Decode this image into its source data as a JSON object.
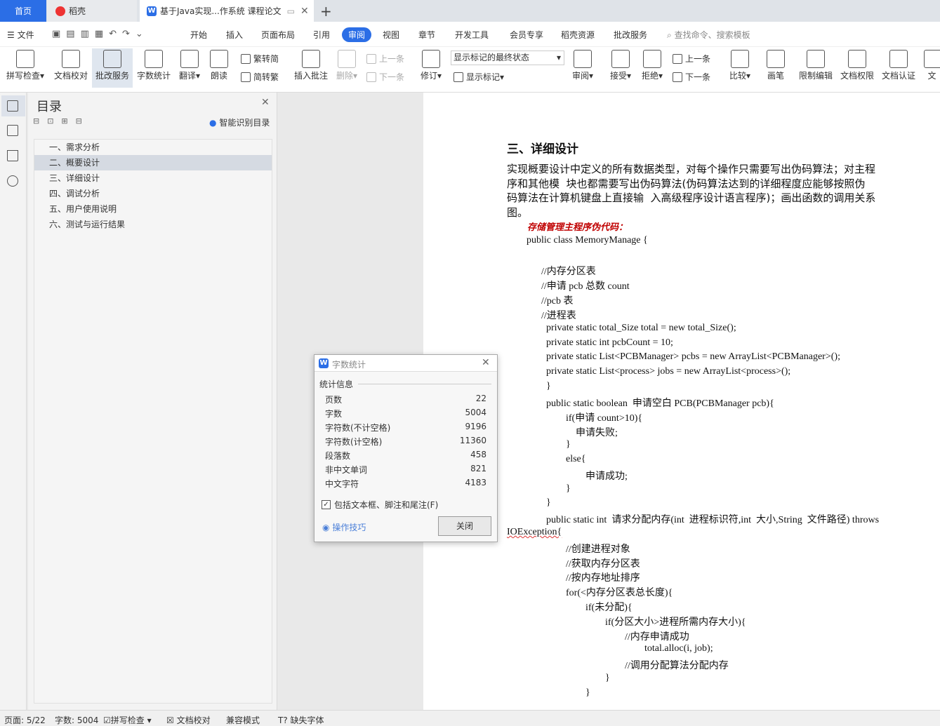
{
  "tabs": {
    "home": "首页",
    "daoke": "稻壳",
    "doc": "基于Java实现...作系统 课程论文"
  },
  "menu": {
    "file": "文件",
    "items": [
      "开始",
      "插入",
      "页面布局",
      "引用",
      "审阅",
      "视图",
      "章节",
      "开发工具",
      "会员专享",
      "稻壳资源",
      "批改服务"
    ],
    "search": "查找命令、搜索模板"
  },
  "ribbon": {
    "spell": "拼写检查",
    "proof": "文档校对",
    "correct": "批改服务",
    "wordcount": "字数统计",
    "translate": "翻译",
    "read": "朗读",
    "trad": "繁转简",
    "simp": "简转繁",
    "insert_comment": "插入批注",
    "delete": "删除",
    "prev": "上一条",
    "next": "下一条",
    "revise": "修订",
    "markup_state": "显示标记的最终状态",
    "show_markup": "显示标记",
    "review": "审阅",
    "accept": "接受",
    "reject": "拒绝",
    "prev2": "上一条",
    "next2": "下一条",
    "compare": "比较",
    "pen": "画笔",
    "restrict": "限制编辑",
    "permission": "文档权限",
    "certify": "文档认证",
    "more": "文"
  },
  "toc": {
    "title": "目录",
    "smart": "智能识别目录",
    "items": [
      "一、需求分析",
      "二、概要设计",
      "三、详细设计",
      "四、调试分析",
      "五、用户使用说明",
      "六、测试与运行结果"
    ],
    "selected_index": 1
  },
  "doc": {
    "heading": "三、详细设计",
    "para": [
      "实现概要设计中定义的所有数据类型，对每个操作只需要写出伪码算法；对主程",
      "序和其他模  块也都需要写出伪码算法(伪码算法达到的详细程度应能够按照伪",
      "码算法在计算机键盘上直接输  入高级程序设计语言程序)；画出函数的调用关系",
      "图。"
    ],
    "code_title": "存储管理主程序伪代码：",
    "code": [
      "public class MemoryManage {",
      "",
      "//内存分区表",
      "//申请 pcb 总数 count",
      "//pcb 表",
      "//进程表",
      "private static total_Size total = new total_Size();",
      "private static int pcbCount = 10;",
      "private static List<PCBManager> pcbs = new ArrayList<PCBManager>();",
      "private static List<process> jobs = new ArrayList<process>();",
      "}",
      "public static boolean  申请空白 PCB(PCBManager pcb){",
      "if(申请 count>10){",
      "申请失败;",
      "}",
      "else{",
      "申请成功;",
      "}",
      "}",
      "public static int  请求分配内存(int  进程标识符,int  大小,String  文件路径) throws",
      "IOException{",
      "//创建进程对象",
      "//获取内存分区表",
      "//按内存地址排序",
      "for(<内存分区表总长度){",
      "if(未分配){",
      "if(分区大小>进程所需内存大小){",
      "//内存申请成功",
      "total.alloc(i, job);",
      "//调用分配算法分配内存",
      "}",
      "}"
    ]
  },
  "dialog": {
    "title": "字数统计",
    "section": "统计信息",
    "rows": [
      {
        "label": "页数",
        "value": "22"
      },
      {
        "label": "字数",
        "value": "5004"
      },
      {
        "label": "字符数(不计空格)",
        "value": "9196"
      },
      {
        "label": "字符数(计空格)",
        "value": "11360"
      },
      {
        "label": "段落数",
        "value": "458"
      },
      {
        "label": "非中文单词",
        "value": "821"
      },
      {
        "label": "中文字符",
        "value": "4183"
      }
    ],
    "checkbox": "包括文本框、脚注和尾注(F)",
    "tips": "操作技巧",
    "close": "关闭"
  },
  "status": {
    "page": "页面: 5/22",
    "words": "字数: 5004",
    "spell": "拼写检查",
    "proof": "文档校对",
    "compat": "兼容模式",
    "missing_font": "缺失字体"
  },
  "colors": {
    "accent": "#2b6ee6",
    "code_title": "#c00000"
  }
}
